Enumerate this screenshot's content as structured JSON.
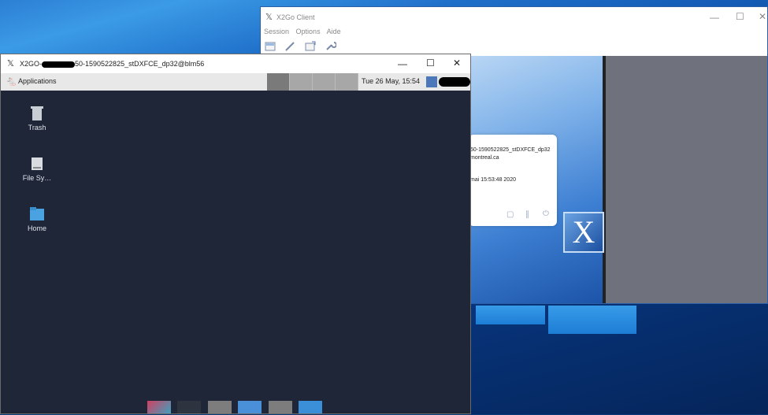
{
  "desktop": {
    "label": "Windows desktop"
  },
  "client_window": {
    "title": "X2Go Client",
    "menu": [
      "Session",
      "Options",
      "Aide"
    ],
    "toolbar_icons": [
      "new-session-icon",
      "edit-session-icon",
      "export-session-icon",
      "preferences-icon"
    ],
    "session_card": {
      "line1": "50-1590522825_stDXFCE_dp32",
      "line2": "montreal.ca",
      "line3": "mai 15:53:48 2020"
    },
    "logo_letter": "X",
    "controls": {
      "minimize": "—",
      "maximize": "☐",
      "close": "✕"
    }
  },
  "session_window": {
    "title_prefix": "X2GO-",
    "title_suffix": "50-1590522825_stDXFCE_dp32@blm56",
    "controls": {
      "minimize": "—",
      "maximize": "☐",
      "close": "✕"
    },
    "panel": {
      "applications_label": "Applications",
      "clock": "Tue 26 May, 15:54"
    },
    "desktop_icons": [
      {
        "name": "trash",
        "label": "Trash"
      },
      {
        "name": "file-system",
        "label": "File Sy…"
      },
      {
        "name": "home",
        "label": "Home"
      }
    ]
  }
}
